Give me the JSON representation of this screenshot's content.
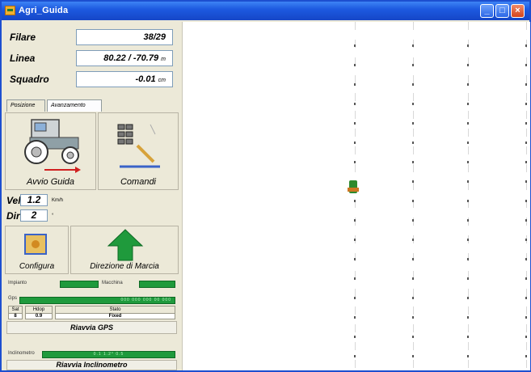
{
  "window": {
    "title": "Agri_Guida"
  },
  "fields": [
    {
      "label": "Filare",
      "value": "38/29",
      "unit": ""
    },
    {
      "label": "Linea",
      "value": "80.22 / -70.79",
      "unit": "m"
    },
    {
      "label": "Squadro",
      "value": "-0.01",
      "unit": "cm"
    }
  ],
  "tabs": [
    "Posizione",
    "Avanzamento"
  ],
  "buttons": {
    "avvio": "Avvio Guida",
    "comandi": "Comandi",
    "configura": "Configura",
    "direzione": "Direzione di Marcia",
    "gps": "Riavvia GPS",
    "inclinometro": "Riavvia Inclinometro"
  },
  "vel": {
    "label": "Vel",
    "value": "1.2",
    "unit": "Km/h"
  },
  "dir": {
    "label": "Dir",
    "value": "2",
    "unit": "°"
  },
  "status": {
    "impianto": "Impianto",
    "macchina": "Macchina",
    "gps_label": "Gps",
    "gps_bar": "000 000 000 00 000",
    "sat_label": "Sat",
    "sat_value": "8",
    "hdop_label": "Hdop",
    "hdop_value": "0.9",
    "stato_label": "Stato",
    "stato_value": "Fixed",
    "inclinometro_label": "Inclinometro",
    "inclinometro_bar": "0.1  1.2°  0.5"
  },
  "colors": {
    "accent": "#1f9a3c",
    "titlebar": "#1d5ae0",
    "arrow": "#1f9a3c"
  }
}
